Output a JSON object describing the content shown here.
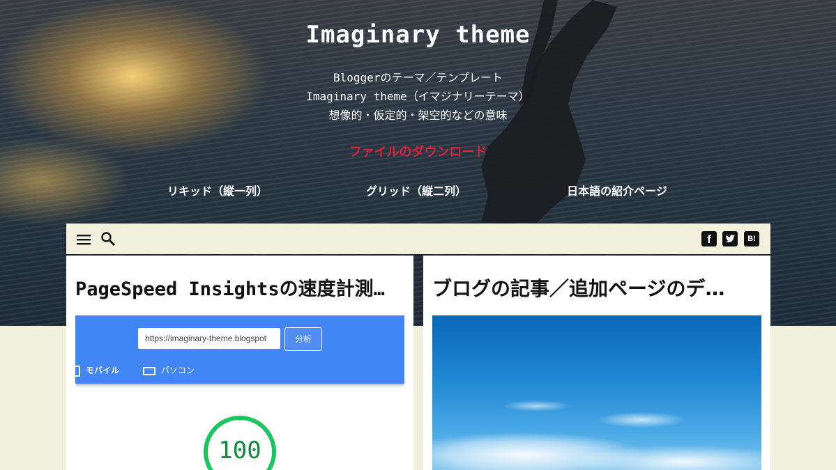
{
  "header": {
    "site_title": "Imaginary theme",
    "description_lines": [
      "Bloggerのテーマ／テンプレート",
      "Imaginary theme（イマジナリーテーマ）",
      "想像的・仮定的・架空的などの意味"
    ],
    "download_link": "ファイルのダウンロード",
    "layout_links": [
      "リキッド（縦一列）",
      "グリッド（縦二列）",
      "日本語の紹介ページ"
    ]
  },
  "toolbar": {
    "left_icons": [
      "menu-icon",
      "search-icon"
    ],
    "share_buttons": [
      {
        "name": "facebook-icon",
        "glyph": "f"
      },
      {
        "name": "twitter-icon",
        "glyph": ""
      },
      {
        "name": "hatena-bookmark-icon",
        "glyph": "B!"
      }
    ]
  },
  "posts": [
    {
      "title": "PageSpeed Insightsの速度計測…",
      "thumbnail": {
        "url_field": "https://imaginary-theme.blogspot",
        "analyze_button": "分析",
        "tabs": [
          "モバイル",
          "パソコン"
        ],
        "score": "100"
      }
    },
    {
      "title": "ブログの記事／追加ページのデ…"
    }
  ],
  "colors": {
    "page_background": "#f2f1dd",
    "download_link": "#e0203a",
    "pagespeed_blue": "#4285f4",
    "score_green": "#19c65f"
  }
}
